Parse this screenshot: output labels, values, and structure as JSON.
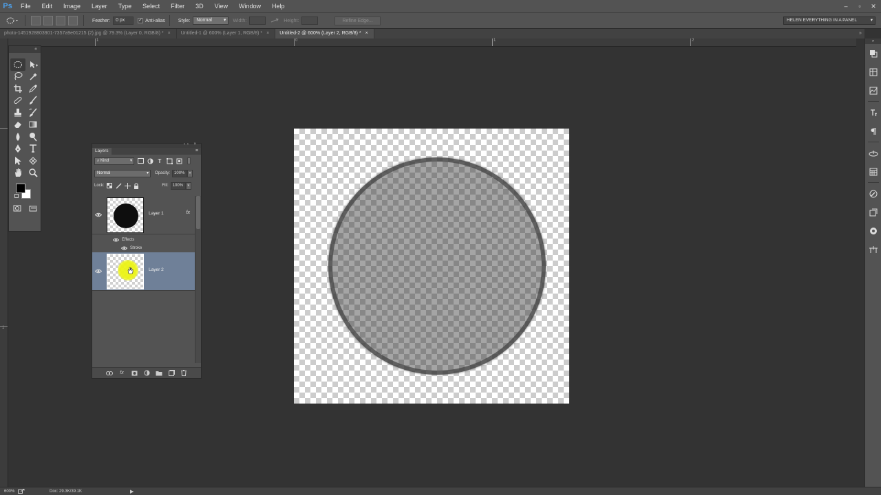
{
  "app": {
    "logo": "Ps"
  },
  "menu": [
    "File",
    "Edit",
    "Image",
    "Layer",
    "Type",
    "Select",
    "Filter",
    "3D",
    "View",
    "Window",
    "Help"
  ],
  "window_controls": [
    "–",
    "▫",
    "✕"
  ],
  "options_bar": {
    "feather_label": "Feather:",
    "feather_value": "0 px",
    "antialias_label": "Anti-alias",
    "antialias_checked": true,
    "style_label": "Style:",
    "style_value": "Normal",
    "width_label": "Width:",
    "height_label": "Height:",
    "refine_edge_label": "Refine Edge...",
    "workspace": "HELEN EVERYTHING IN A PANEL"
  },
  "doc_tabs": [
    {
      "label": "photo-1451928803901-7357a9e01215 (2).jpg @ 79.3% (Layer 0, RGB/8) *",
      "active": false
    },
    {
      "label": "Untitled-1 @ 600% (Layer 1, RGB/8) *",
      "active": false
    },
    {
      "label": "Untitled-2 @ 600% (Layer 2, RGB/8) *",
      "active": true
    }
  ],
  "tab_close_glyph": "×",
  "tab_overflow_glyph": "»",
  "rulers": {
    "top_labels": [
      "1",
      "0",
      "1",
      "2"
    ],
    "left_labels": [
      "1"
    ]
  },
  "toolbox": {
    "collapse_glyph": "«"
  },
  "layers_panel": {
    "tab_label": "Layers",
    "filter_kind": "Kind",
    "blend_mode": "Normal",
    "opacity_label": "Opacity:",
    "opacity_value": "100%",
    "lock_label": "Lock:",
    "fill_label": "Fill:",
    "fill_value": "100%",
    "layers": [
      {
        "name": "Layer 1",
        "has_fx": true,
        "fx_label": "fx",
        "effects_label": "Effects",
        "effect_items": [
          "Stroke"
        ],
        "selected": false
      },
      {
        "name": "Layer 2",
        "has_fx": false,
        "selected": true
      }
    ],
    "footer_icons": [
      "link-icon",
      "fx-icon",
      "mask-icon",
      "adjustment-icon",
      "folder-icon",
      "new-layer-icon",
      "trash-icon"
    ]
  },
  "colors": {
    "foreground": "#000000",
    "background": "#ffffff",
    "selection": "#6f8098",
    "highlight": "#ecf414"
  },
  "status_bar": {
    "zoom": "600%",
    "doc_info": "Doc: 29.3K/39.1K"
  }
}
